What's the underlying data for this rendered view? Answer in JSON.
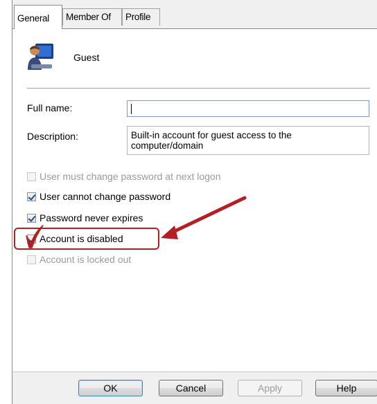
{
  "tabs": [
    {
      "label": "General",
      "active": true
    },
    {
      "label": "Member Of",
      "active": false
    },
    {
      "label": "Profile",
      "active": false
    }
  ],
  "user": {
    "name": "Guest",
    "icon": "user-account-icon"
  },
  "full_name": {
    "label": "Full name:",
    "value": ""
  },
  "description": {
    "label": "Description:",
    "value": "Built-in account for guest access to the computer/domain"
  },
  "checkboxes": [
    {
      "label": "User must change password at next logon",
      "checked": false,
      "enabled": false
    },
    {
      "label": "User cannot change password",
      "checked": true,
      "enabled": true
    },
    {
      "label": "Password never expires",
      "checked": true,
      "enabled": true
    },
    {
      "label": "Account is disabled",
      "checked": true,
      "enabled": true
    },
    {
      "label": "Account is locked out",
      "checked": false,
      "enabled": false
    }
  ],
  "buttons": {
    "ok": "OK",
    "cancel": "Cancel",
    "apply": "Apply",
    "help": "Help"
  },
  "annotation": {
    "color": "#b21f24",
    "icon": "red-checkmark-icon"
  }
}
